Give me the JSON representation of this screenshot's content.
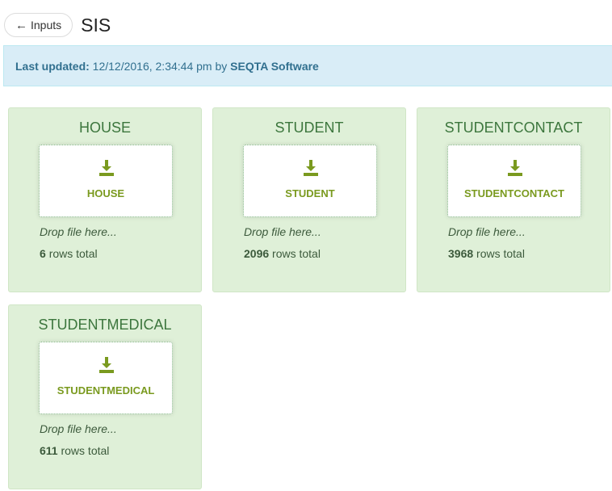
{
  "header": {
    "back_label": "Inputs",
    "back_arrow": "←",
    "title": "SIS"
  },
  "alert": {
    "prefix": "Last updated:",
    "datetime": "12/12/2016, 2:34:44 pm",
    "by": "by",
    "author": "SEQTA Software"
  },
  "common": {
    "drop_hint": "Drop file here...",
    "rows_suffix": "rows total"
  },
  "cards": [
    {
      "title": "HOUSE",
      "button": "HOUSE",
      "rows": "6"
    },
    {
      "title": "STUDENT",
      "button": "STUDENT",
      "rows": "2096"
    },
    {
      "title": "STUDENTCONTACT",
      "button": "STUDENTCONTACT",
      "rows": "3968"
    },
    {
      "title": "STUDENTMEDICAL",
      "button": "STUDENTMEDICAL",
      "rows": "611"
    }
  ],
  "colors": {
    "card_bg": "#dff0d8",
    "card_title": "#3c763d",
    "upload_accent": "#7a9a1f",
    "alert_bg": "#d9edf7",
    "alert_text": "#31708f"
  }
}
